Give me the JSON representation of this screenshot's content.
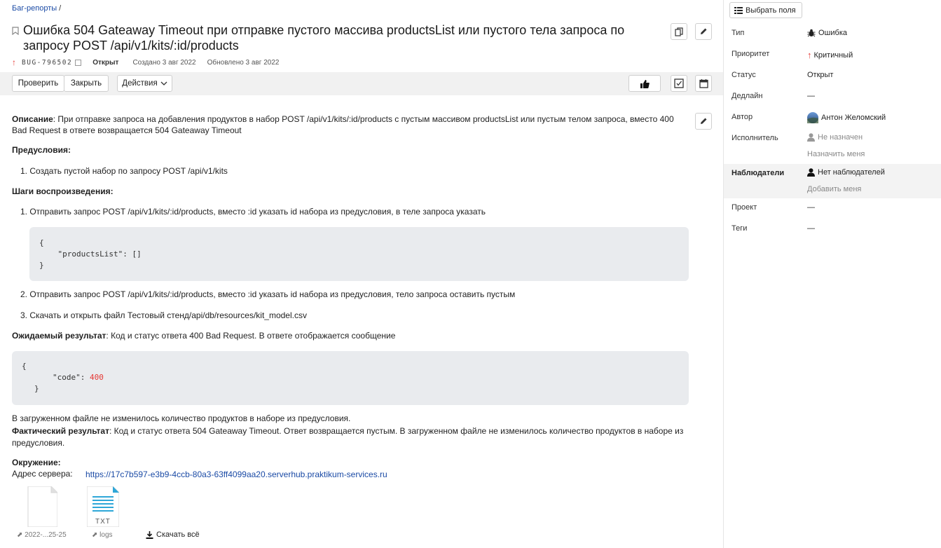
{
  "breadcrumb": {
    "link": "Баг-репорты",
    "sep": "/"
  },
  "issue": {
    "title": "Ошибка 504 Gateaway Timeout при отправке пустого массива productsList или пустого тела запроса по запросу POST /api/v1/kits/:id/products",
    "key": "BUG-796502",
    "status": "Открыт",
    "created": "Создано 3 авг 2022",
    "updated": "Обновлено 3 авг 2022"
  },
  "toolbar": {
    "check": "Проверить",
    "close": "Закрыть",
    "actions": "Действия"
  },
  "description": {
    "desc_label": "Описание",
    "desc_text": ": При отправке запроса на добавления продуктов в набор POST /api/v1/kits/:id/products с пустым массивом productsList или пустым телом запроса, вместо 400 Bad Request в ответе возвращается 504 Gateaway Timeout",
    "pre_label": "Предусловия:",
    "pre_items": [
      "1. Создать пустой набор по запросу POST /api/v1/kits"
    ],
    "steps_label": "Шаги воспроизведения:",
    "step1": "1. Отправить запрос POST /api/v1/kits/:id/products, вместо :id указать id набора из предусловия, в теле запроса указать",
    "code1": [
      "{",
      "    \"productsList\": []",
      "}"
    ],
    "step2": "2. Отправить запрос POST /api/v1/kits/:id/products, вместо :id указать id набора из предусловия, тело запроса оставить пустым",
    "step3": "3. Скачать и открыть файл Тестовый стенд/api/db/resources/kit_model.csv",
    "expected_label": "Ожидаемый результат",
    "expected_text": ": Код и статус ответа 400 Bad Request. В ответе отображается сообщение",
    "code2_open": "{",
    "code2_key": "\"code\": ",
    "code2_val": "400",
    "code2_close": "}",
    "after_code": "В загруженном файле не изменилось количество продуктов в наборе из предусловия.",
    "actual_label": "Фактический результат",
    "actual_text": ": Код и статус ответа 504 Gateaway Timeout. Ответ возвращается пустым. В загруженном файле не изменилось количество продуктов в наборе из предусловия.",
    "env_label": "Окружение:",
    "server_label": "Адрес сервера:",
    "server_url": "https://17c7b597-e3b9-4ccb-80a3-63ff4099aa20.serverhub.praktikum-services.ru"
  },
  "attachments": [
    {
      "name": "2022-...25-25",
      "type": ""
    },
    {
      "name": "logs",
      "type": "TXT"
    }
  ],
  "download_all": "Скачать всё",
  "sidebar": {
    "choose_fields": "Выбрать поля",
    "rows": [
      {
        "label": "Тип",
        "value": "Ошибка"
      },
      {
        "label": "Приоритет",
        "value": "Критичный"
      },
      {
        "label": "Статус",
        "value": "Открыт"
      },
      {
        "label": "Дедлайн",
        "value": "—"
      },
      {
        "label": "Автор",
        "value": "Антон Желомский"
      },
      {
        "label": "Исполнитель",
        "value": "Не назначен",
        "sub": "Назначить меня"
      },
      {
        "label": "Наблюдатели",
        "value": "Нет наблюдателей",
        "sub": "Добавить меня"
      },
      {
        "label": "Проект",
        "value": "—"
      },
      {
        "label": "Теги",
        "value": "—"
      }
    ]
  },
  "colors": {
    "accent": "#1a4aa5",
    "priority": "#e53935",
    "code_bg": "#e9ebee"
  }
}
